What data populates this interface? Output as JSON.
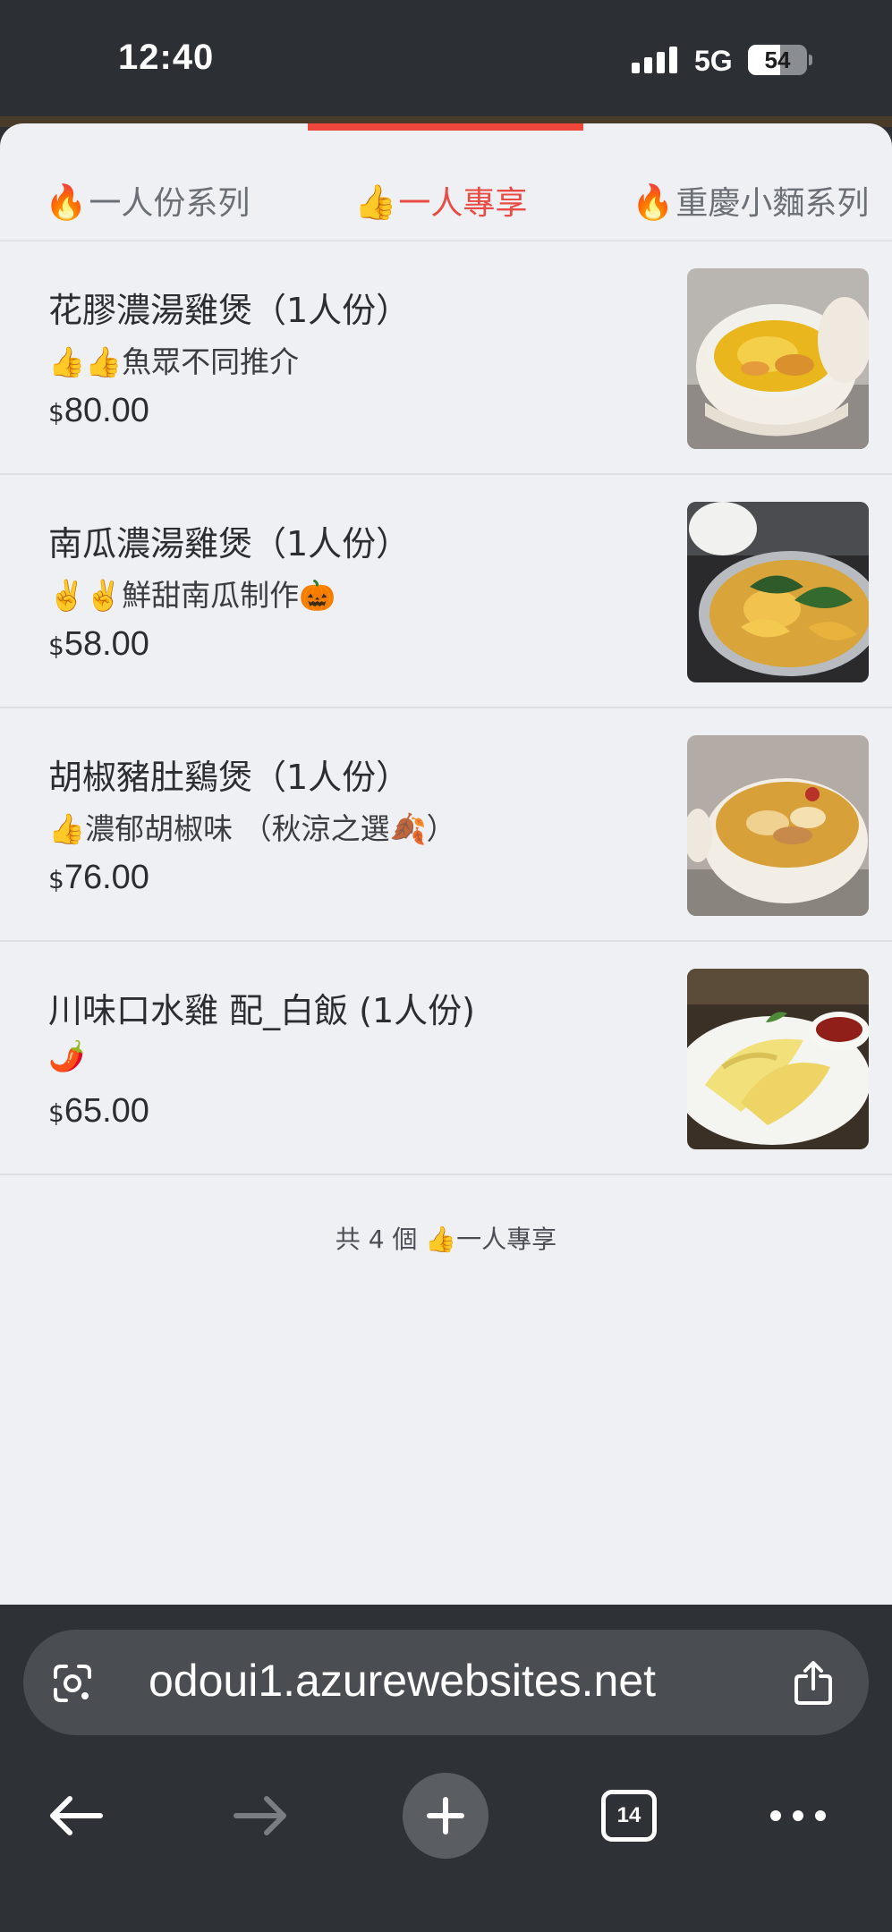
{
  "status_bar": {
    "time": "12:40",
    "network": "5G",
    "battery": "54",
    "battery_level": 0.54
  },
  "tabs": [
    {
      "emoji": "🔥",
      "label": "一人份系列",
      "active": false
    },
    {
      "emoji": "👍",
      "label": "一人專享",
      "active": true
    },
    {
      "emoji": "🔥",
      "label": "重慶小麵系列",
      "active": false
    }
  ],
  "items": [
    {
      "name": "花膠濃湯雞煲（1人份）",
      "desc": "👍👍魚眾不同推介",
      "currency": "$",
      "price": "80.00",
      "photo": "clay-pot-chicken-soup-photo"
    },
    {
      "name": "南瓜濃湯雞煲（1人份）",
      "desc": "✌️✌️鮮甜南瓜制作🎃",
      "currency": "$",
      "price": "58.00",
      "photo": "pumpkin-chicken-pot-photo"
    },
    {
      "name": "胡椒豬肚鷄煲（1人份）",
      "desc": "👍濃郁胡椒味 （秋涼之選🍂）",
      "currency": "$",
      "price": "76.00",
      "photo": "pepper-pork-tripe-pot-photo"
    },
    {
      "name": "川味口水雞 配_白飯 (1人份)",
      "desc": "🌶️",
      "currency": "$",
      "price": "65.00",
      "photo": "sichuan-chicken-rice-photo"
    }
  ],
  "footer_count": "共 4 個 👍一人專享",
  "browser": {
    "url": "odoui1.azurewebsites.net",
    "tab_count": "14"
  },
  "colors": {
    "accent": "#ea4b45",
    "sheet_bg": "#eef0f3",
    "chrome_bg": "#2e3135"
  }
}
